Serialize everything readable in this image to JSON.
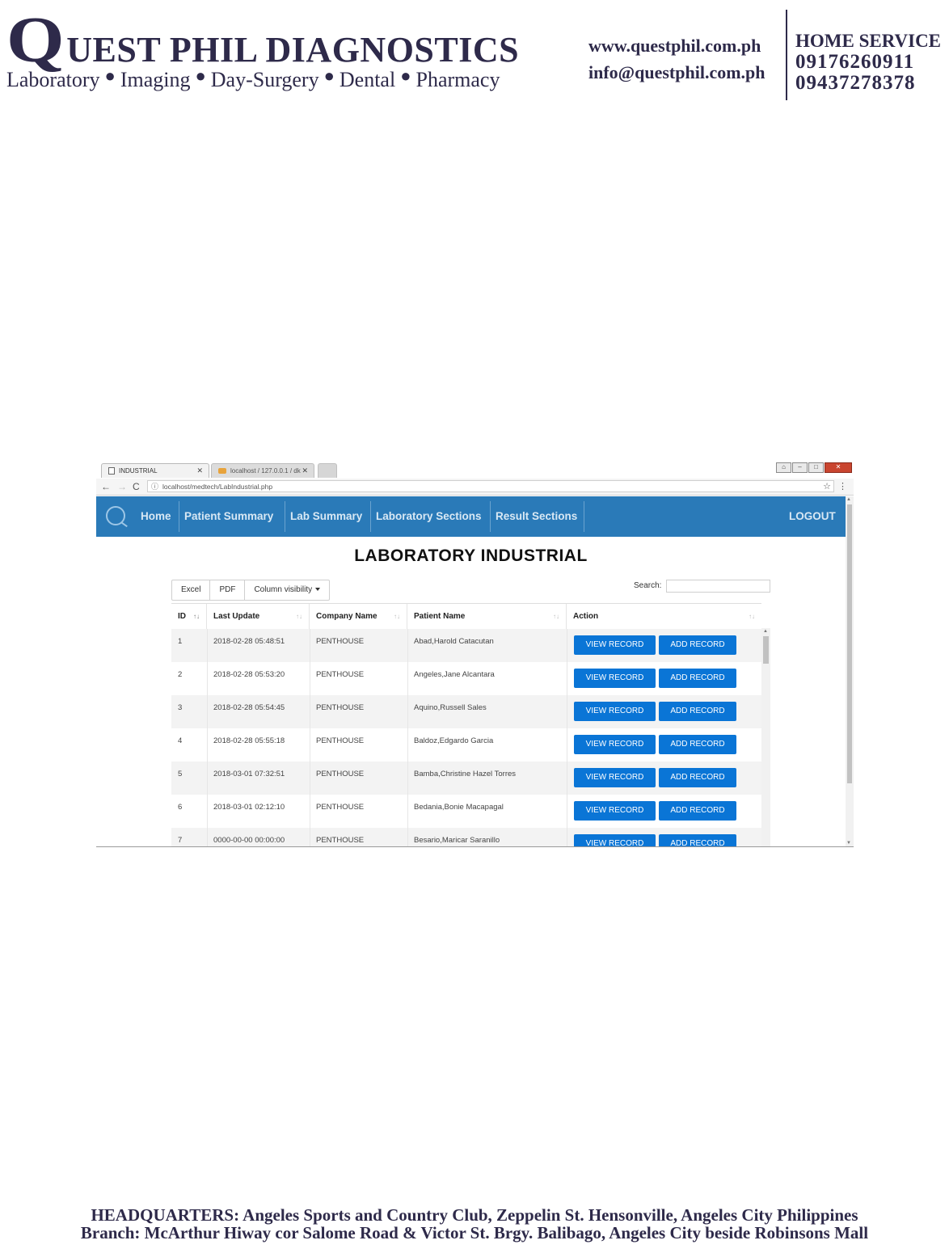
{
  "letterhead": {
    "brand_initial": "Q",
    "brand_rest": "UEST PHIL DIAGNOSTICS",
    "services": [
      "Laboratory",
      "Imaging",
      "Day-Surgery",
      "Dental",
      "Pharmacy"
    ],
    "website": "www.questphil.com.ph",
    "email": "info@questphil.com.ph",
    "home_service_label": "HOME SERVICE",
    "phones": [
      "09176260911",
      "09437278378"
    ],
    "footer_line1": "HEADQUARTERS: Angeles Sports and Country Club, Zeppelin St. Hensonville, Angeles City Philippines",
    "footer_line2": "Branch: McArthur Hiway cor Salome Road & Victor St. Brgy. Balibago, Angeles City beside Robinsons Mall",
    "color": "#2e2a4a"
  },
  "browser": {
    "tabs": [
      {
        "label": "INDUSTRIAL",
        "active": true
      },
      {
        "label": "localhost / 127.0.0.1 / dk",
        "active": false
      }
    ],
    "url": "localhost/medtech/LabIndustrial.php"
  },
  "app": {
    "nav": {
      "items": [
        "Home",
        "Patient Summary",
        "Lab Summary",
        "Laboratory Sections",
        "Result Sections"
      ],
      "logout": "LOGOUT",
      "color": "#2a7ab8"
    },
    "page_title": "LABORATORY INDUSTRIAL",
    "toolbar": {
      "excel": "Excel",
      "pdf": "PDF",
      "column_visibility": "Column visibility",
      "search_label": "Search:",
      "search_value": ""
    },
    "table": {
      "columns": [
        "ID",
        "Last Update",
        "Company Name",
        "Patient Name",
        "Action"
      ],
      "rows": [
        {
          "id": "1",
          "last_update": "2018-02-28 05:48:51",
          "company": "PENTHOUSE",
          "patient": "Abad,Harold Catacutan"
        },
        {
          "id": "2",
          "last_update": "2018-02-28 05:53:20",
          "company": "PENTHOUSE",
          "patient": "Angeles,Jane Alcantara"
        },
        {
          "id": "3",
          "last_update": "2018-02-28 05:54:45",
          "company": "PENTHOUSE",
          "patient": "Aquino,Russell Sales"
        },
        {
          "id": "4",
          "last_update": "2018-02-28 05:55:18",
          "company": "PENTHOUSE",
          "patient": "Baldoz,Edgardo Garcia"
        },
        {
          "id": "5",
          "last_update": "2018-03-01 07:32:51",
          "company": "PENTHOUSE",
          "patient": "Bamba,Christine Hazel Torres"
        },
        {
          "id": "6",
          "last_update": "2018-03-01 02:12:10",
          "company": "PENTHOUSE",
          "patient": "Bedania,Bonie Macapagal"
        },
        {
          "id": "7",
          "last_update": "0000-00-00 00:00:00",
          "company": "PENTHOUSE",
          "patient": "Besario,Maricar Saranillo"
        }
      ],
      "view_label": "VIEW RECORD",
      "add_label": "ADD RECORD",
      "button_color": "#0a75d6"
    }
  }
}
